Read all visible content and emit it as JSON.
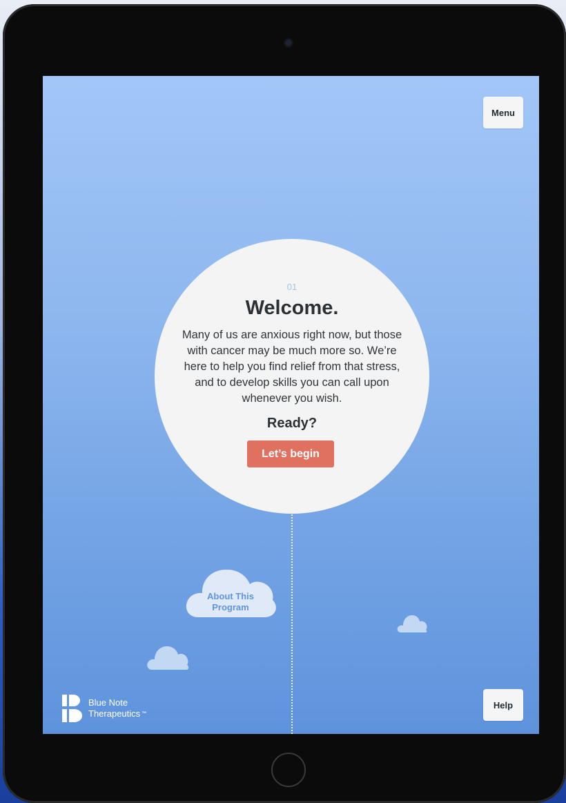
{
  "header": {
    "menu_label": "Menu"
  },
  "welcome": {
    "step_number": "01",
    "title": "Welcome.",
    "body": "Many of us are anxious right now, but those with cancer may be much more so. We’re here to help you find relief from that stress, and to develop skills you can call upon whenever you wish.",
    "ready_label": "Ready?",
    "begin_button_label": "Let’s begin"
  },
  "about": {
    "label_line1": "About This",
    "label_line2": "Program"
  },
  "brand": {
    "name_line1": "Blue Note",
    "name_line2": "Therapeutics",
    "trademark": "™"
  },
  "footer": {
    "help_label": "Help"
  },
  "colors": {
    "accent": "#e07060",
    "sky_top": "#a2c6f7",
    "sky_bottom": "#5e93dc",
    "card": "#f4f4f4",
    "text_dark": "#2b3035"
  },
  "icons": {
    "camera": "camera-icon",
    "home": "home-button-icon",
    "logo": "blue-note-logo-icon",
    "cloud": "cloud-icon"
  }
}
